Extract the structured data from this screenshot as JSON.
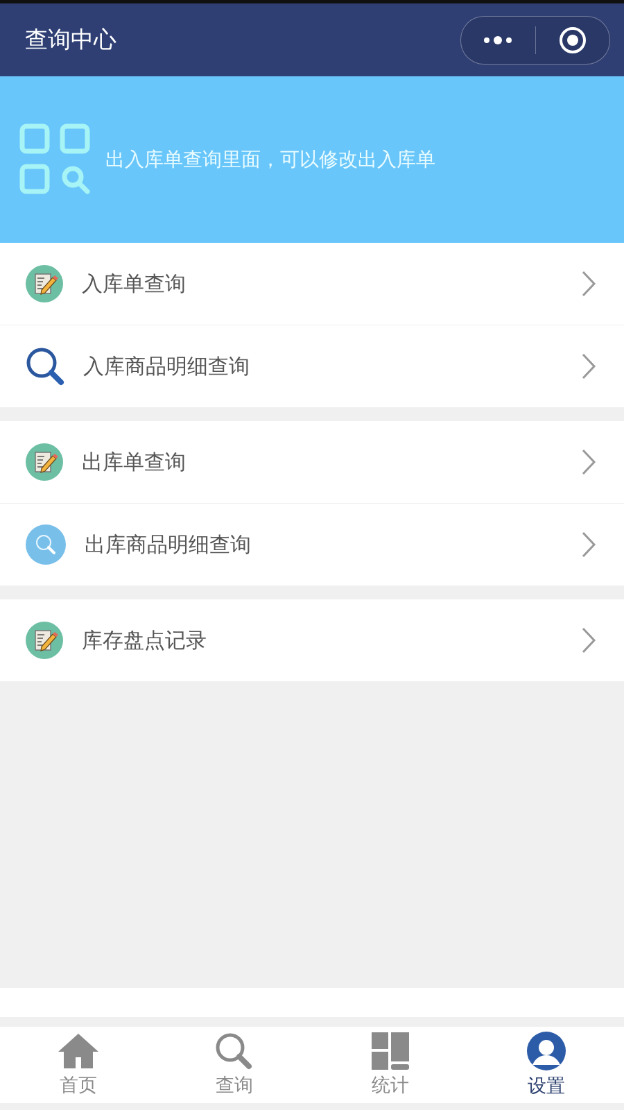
{
  "window": {
    "title": "查询中心"
  },
  "banner": {
    "text": "出入库单查询里面，可以修改出入库单"
  },
  "groups": [
    {
      "items": [
        {
          "label": "入库单查询",
          "kind": "note"
        },
        {
          "label": "入库商品明细查询",
          "kind": "magnifier"
        }
      ]
    },
    {
      "items": [
        {
          "label": "出库单查询",
          "kind": "note"
        },
        {
          "label": "出库商品明细查询",
          "kind": "search-circle"
        }
      ]
    },
    {
      "items": [
        {
          "label": "库存盘点记录",
          "kind": "note"
        }
      ]
    }
  ],
  "tabs": [
    {
      "label": "首页",
      "kind": "home",
      "selected": false
    },
    {
      "label": "查询",
      "kind": "search",
      "selected": false
    },
    {
      "label": "统计",
      "kind": "stats",
      "selected": false
    },
    {
      "label": "设置",
      "kind": "user",
      "selected": true
    }
  ]
}
